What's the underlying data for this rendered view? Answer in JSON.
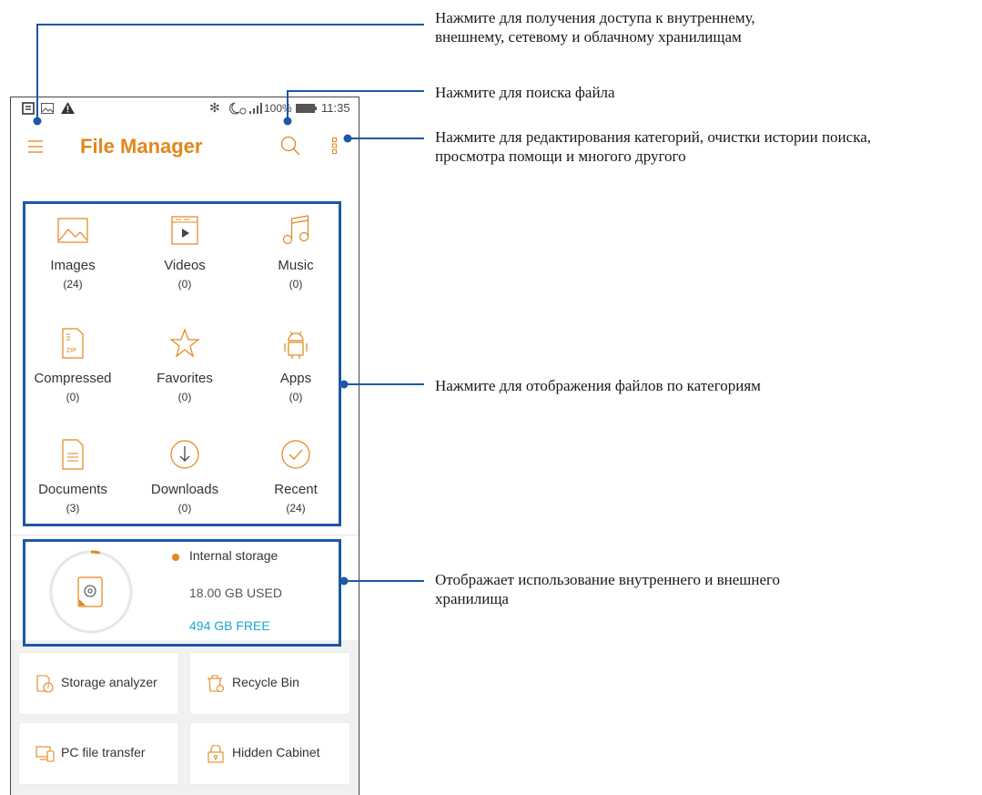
{
  "status_bar": {
    "battery": "100%",
    "time": "11:35"
  },
  "app_bar": {
    "title": "File Manager"
  },
  "categories": [
    {
      "label": "Images",
      "count": "(24)",
      "icon": "image-icon"
    },
    {
      "label": "Videos",
      "count": "(0)",
      "icon": "video-icon"
    },
    {
      "label": "Music",
      "count": "(0)",
      "icon": "music-icon"
    },
    {
      "label": "Compressed",
      "count": "(0)",
      "icon": "zip-icon"
    },
    {
      "label": "Favorites",
      "count": "(0)",
      "icon": "star-icon"
    },
    {
      "label": "Apps",
      "count": "(0)",
      "icon": "android-icon"
    },
    {
      "label": "Documents",
      "count": "(3)",
      "icon": "document-icon"
    },
    {
      "label": "Downloads",
      "count": "(0)",
      "icon": "download-icon"
    },
    {
      "label": "Recent",
      "count": "(24)",
      "icon": "recent-icon"
    }
  ],
  "storage": {
    "name": "Internal storage",
    "used": "18.00 GB USED",
    "free": "494 GB FREE",
    "used_fraction": 0.035
  },
  "tools": [
    {
      "label": "Storage analyzer",
      "icon": "storage-analyzer-icon"
    },
    {
      "label": "Recycle Bin",
      "icon": "recycle-bin-icon"
    },
    {
      "label": "PC file transfer",
      "icon": "pc-transfer-icon"
    },
    {
      "label": "Hidden Cabinet",
      "icon": "lock-icon"
    }
  ],
  "callouts": {
    "storage_access": "Нажмите для получения доступа к внутреннему,\nвнешнему, сетевому и облачному хранилищам",
    "search": "Нажмите для поиска файла",
    "menu": "Нажмите для редактирования категорий, очистки истории поиска,\nпросмотра помощи и многого другого",
    "categories": "Нажмите для отображения файлов по категориям",
    "storage_usage": "Отображает использование внутреннего и внешнего\nхранилища"
  },
  "colors": {
    "accent": "#e3861c",
    "free_text": "#1aa5d6",
    "annotation": "#1c58a6"
  }
}
